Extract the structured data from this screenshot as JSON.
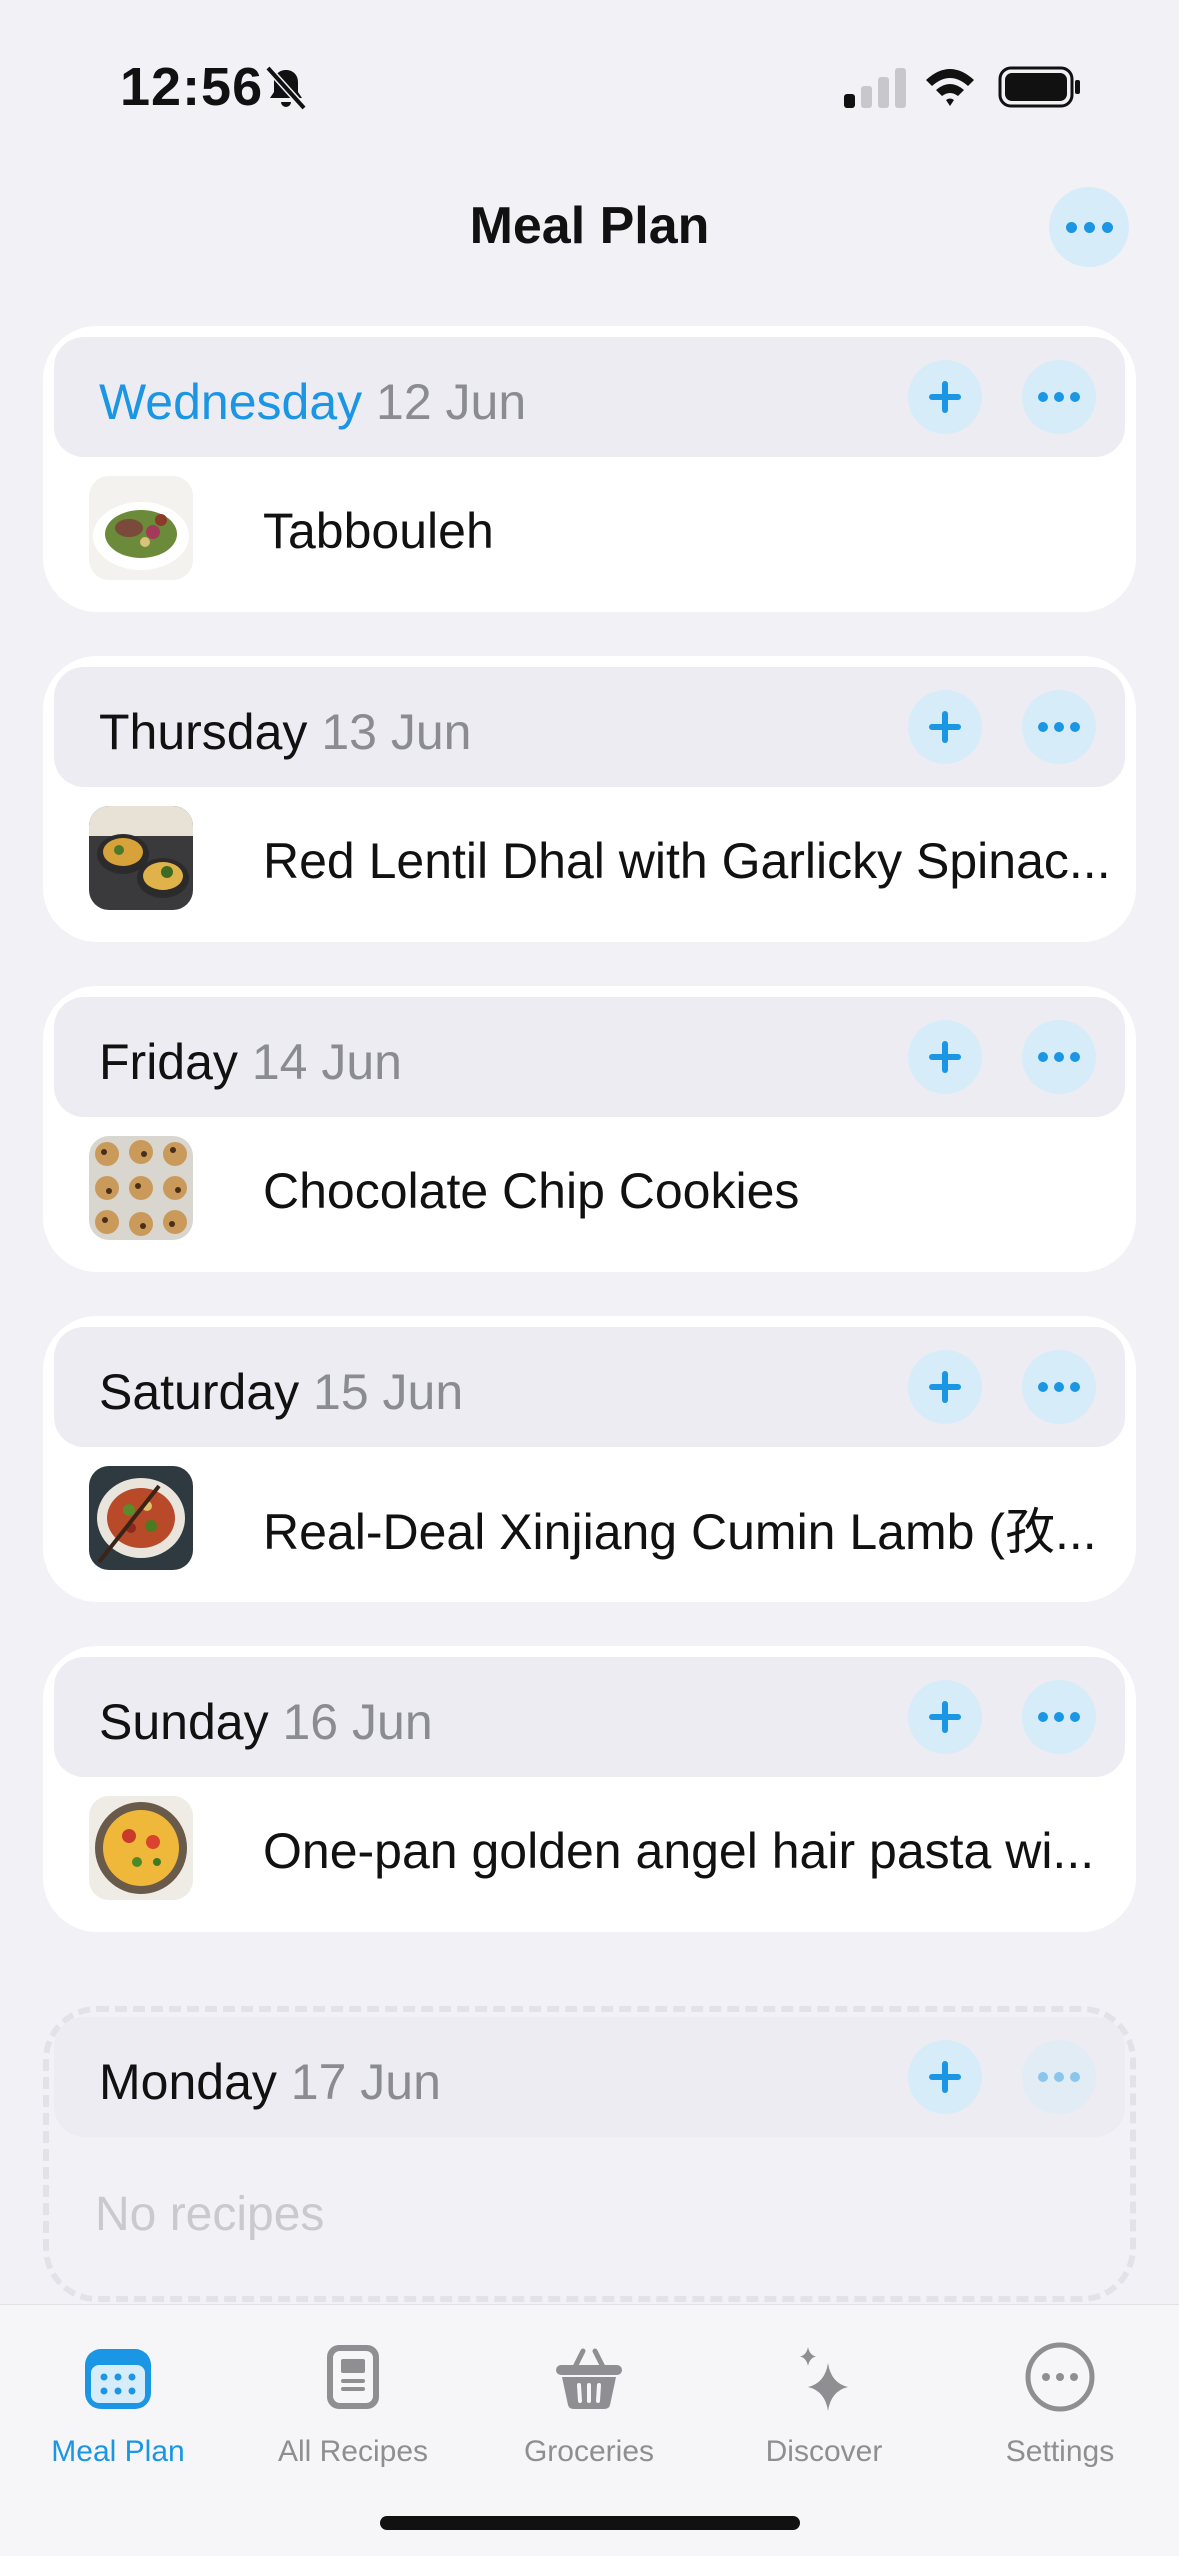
{
  "status_bar": {
    "time": "12:56"
  },
  "nav": {
    "title": "Meal Plan"
  },
  "days": [
    {
      "day": "Wednesday",
      "date": "12 Jun",
      "recipe": "Tabbouleh"
    },
    {
      "day": "Thursday",
      "date": "13 Jun",
      "recipe": "Red Lentil Dhal with Garlicky Spinac..."
    },
    {
      "day": "Friday",
      "date": "14 Jun",
      "recipe": "Chocolate Chip Cookies"
    },
    {
      "day": "Saturday",
      "date": "15 Jun",
      "recipe": "Real-Deal Xinjiang Cumin Lamb (孜..."
    },
    {
      "day": "Sunday",
      "date": "16 Jun",
      "recipe": "One-pan golden angel hair pasta wi..."
    },
    {
      "day": "Monday",
      "date": "17 Jun",
      "empty_text": "No recipes"
    }
  ],
  "tabs": [
    {
      "label": "Meal Plan",
      "icon": "calendar-icon",
      "active": true
    },
    {
      "label": "All Recipes",
      "icon": "recipe-book-icon"
    },
    {
      "label": "Groceries",
      "icon": "basket-icon"
    },
    {
      "label": "Discover",
      "icon": "sparkles-icon"
    },
    {
      "label": "Settings",
      "icon": "ellipsis-circle-icon"
    }
  ],
  "colors": {
    "accent": "#1a96e4",
    "background": "#f2f2f6",
    "header_fill": "#ececf2",
    "secondary_text": "#8b8b92"
  }
}
